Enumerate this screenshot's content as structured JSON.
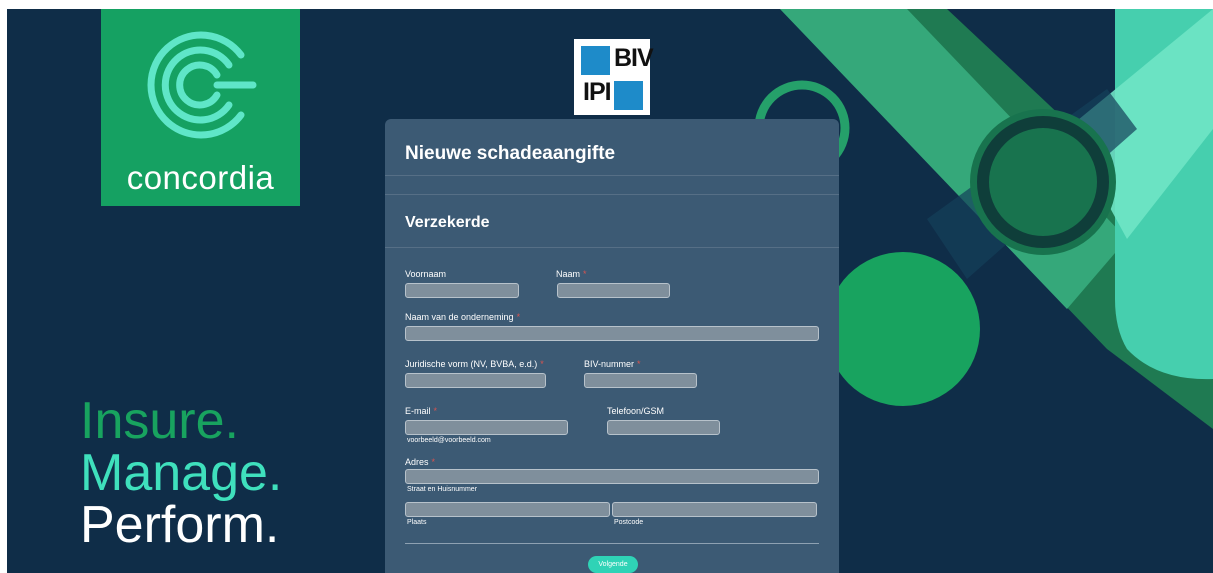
{
  "brand": {
    "logo_text": "concordia",
    "tagline": [
      "Insure.",
      "Manage.",
      "Perform."
    ],
    "colors": {
      "background": "#0f2d48",
      "green": "#15a162",
      "mint": "#3fe0bd",
      "card": "#3c5a74"
    }
  },
  "partner_logo": {
    "line1": "BIV",
    "line2": "IPI"
  },
  "form": {
    "title": "Nieuwe schadeaangifte",
    "section": "Verzekerde",
    "fields": {
      "voornaam": {
        "label": "Voornaam",
        "value": ""
      },
      "naam": {
        "label": "Naam",
        "value": ""
      },
      "onderneming": {
        "label": "Naam van de onderneming",
        "value": ""
      },
      "juridische_vorm": {
        "label": "Juridische vorm (NV, BVBA, e.d.)",
        "value": ""
      },
      "biv_nummer": {
        "label": "BIV-nummer",
        "value": ""
      },
      "email": {
        "label": "E-mail",
        "value": "",
        "hint": "voorbeeld@voorbeeld.com"
      },
      "telefoon": {
        "label": "Telefoon/GSM",
        "value": ""
      },
      "adres": {
        "label": "Adres",
        "value": "",
        "hint": "Straat en Huisnummer"
      },
      "plaats": {
        "hint": "Plaats",
        "value": ""
      },
      "postcode": {
        "hint": "Postcode",
        "value": ""
      }
    },
    "required_mark": "*",
    "next_button": "Volgende"
  }
}
